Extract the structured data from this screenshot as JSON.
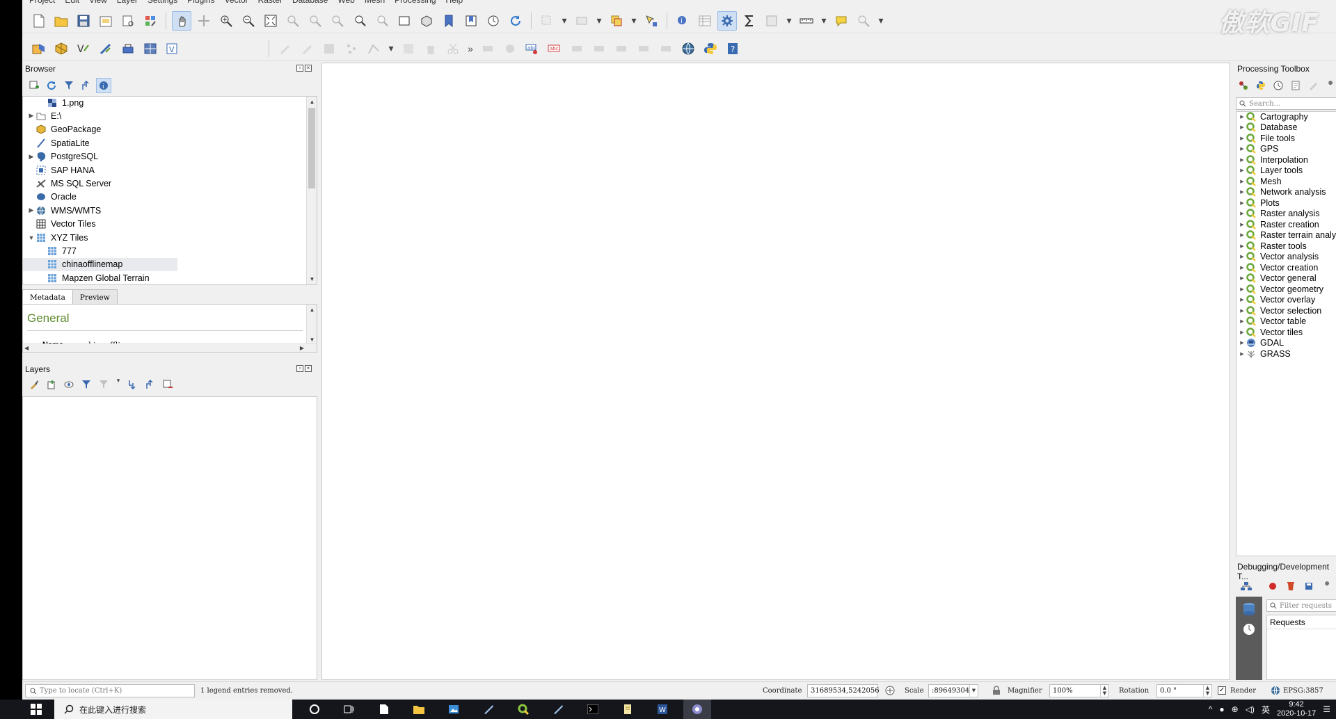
{
  "menubar": [
    "Project",
    "Edit",
    "View",
    "Layer",
    "Settings",
    "Plugins",
    "Vector",
    "Raster",
    "Database",
    "Web",
    "Mesh",
    "Processing",
    "Help"
  ],
  "watermark": "傲软GIF",
  "browser": {
    "title": "Browser",
    "items": [
      {
        "label": "1.png",
        "icon": "raster-file-icon",
        "indent": 2,
        "arrow": ""
      },
      {
        "label": "E:\\",
        "icon": "folder-icon",
        "indent": 1,
        "arrow": "▶"
      },
      {
        "label": "GeoPackage",
        "icon": "geopackage-icon",
        "indent": 1,
        "arrow": ""
      },
      {
        "label": "SpatiaLite",
        "icon": "spatialite-icon",
        "indent": 1,
        "arrow": ""
      },
      {
        "label": "PostgreSQL",
        "icon": "postgresql-icon",
        "indent": 1,
        "arrow": "▶"
      },
      {
        "label": "SAP HANA",
        "icon": "sap-hana-icon",
        "indent": 1,
        "arrow": ""
      },
      {
        "label": "MS SQL Server",
        "icon": "mssql-icon",
        "indent": 1,
        "arrow": ""
      },
      {
        "label": "Oracle",
        "icon": "oracle-icon",
        "indent": 1,
        "arrow": ""
      },
      {
        "label": "WMS/WMTS",
        "icon": "wms-icon",
        "indent": 1,
        "arrow": "▶"
      },
      {
        "label": "Vector Tiles",
        "icon": "vector-tiles-icon",
        "indent": 1,
        "arrow": ""
      },
      {
        "label": "XYZ Tiles",
        "icon": "xyz-tiles-icon",
        "indent": 1,
        "arrow": "▼"
      },
      {
        "label": "777",
        "icon": "xyz-layer-icon",
        "indent": 2,
        "arrow": ""
      },
      {
        "label": "chinaofflinemap",
        "icon": "xyz-layer-icon",
        "indent": 2,
        "arrow": "",
        "selected": true
      },
      {
        "label": "Mapzen Global Terrain",
        "icon": "xyz-layer-icon",
        "indent": 2,
        "arrow": ""
      }
    ],
    "tabs": [
      "Metadata",
      "Preview"
    ],
    "metadata": {
      "heading": "General",
      "name_key": "Name",
      "name_value": "chinaofflinemap"
    }
  },
  "layers": {
    "title": "Layers"
  },
  "processing": {
    "title": "Processing Toolbox",
    "search_placeholder": "Search…",
    "items": [
      {
        "label": "Cartography",
        "icon": "q"
      },
      {
        "label": "Database",
        "icon": "q"
      },
      {
        "label": "File tools",
        "icon": "q"
      },
      {
        "label": "GPS",
        "icon": "q"
      },
      {
        "label": "Interpolation",
        "icon": "q"
      },
      {
        "label": "Layer tools",
        "icon": "q"
      },
      {
        "label": "Mesh",
        "icon": "q"
      },
      {
        "label": "Network analysis",
        "icon": "q"
      },
      {
        "label": "Plots",
        "icon": "q"
      },
      {
        "label": "Raster analysis",
        "icon": "q"
      },
      {
        "label": "Raster creation",
        "icon": "q"
      },
      {
        "label": "Raster terrain analysis",
        "icon": "q"
      },
      {
        "label": "Raster tools",
        "icon": "q"
      },
      {
        "label": "Vector analysis",
        "icon": "q"
      },
      {
        "label": "Vector creation",
        "icon": "q"
      },
      {
        "label": "Vector general",
        "icon": "q"
      },
      {
        "label": "Vector geometry",
        "icon": "q"
      },
      {
        "label": "Vector overlay",
        "icon": "q"
      },
      {
        "label": "Vector selection",
        "icon": "q"
      },
      {
        "label": "Vector table",
        "icon": "q"
      },
      {
        "label": "Vector tiles",
        "icon": "q"
      },
      {
        "label": "GDAL",
        "icon": "gdal"
      },
      {
        "label": "GRASS",
        "icon": "grass"
      }
    ]
  },
  "debug": {
    "title": "Debugging/Development T...",
    "filter_placeholder": "Filter requests",
    "requests_header": "Requests"
  },
  "status": {
    "locator_placeholder": "Type to locate (Ctrl+K)",
    "message": "1 legend entries removed.",
    "coordinate_label": "Coordinate",
    "coordinate_value": "31689534,5242056",
    "scale_label": "Scale",
    "scale_value": ":89649304",
    "magnifier_label": "Magnifier",
    "magnifier_value": "100%",
    "rotation_label": "Rotation",
    "rotation_value": "0.0 °",
    "render_label": "Render",
    "crs": "EPSG:3857"
  },
  "taskbar": {
    "search_placeholder": "在此键入进行搜索",
    "time": "9:42",
    "date": "2020-10-17",
    "ime": "英"
  },
  "colors": {
    "qgis_green": "#5d8a2c",
    "accent_blue": "#cfe0f5"
  }
}
